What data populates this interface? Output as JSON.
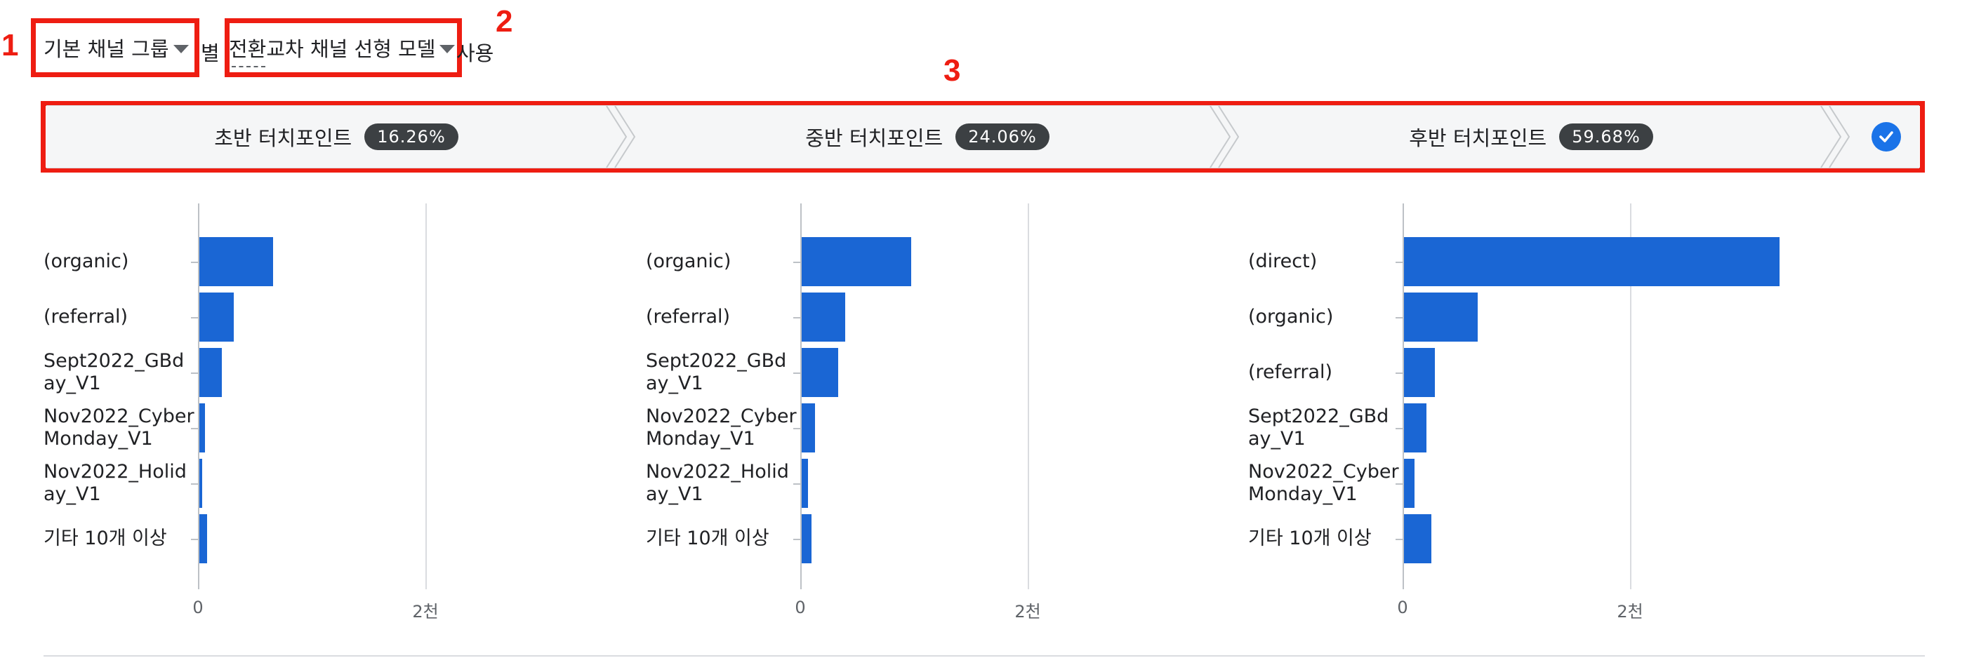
{
  "controls": {
    "channel_group": "기본 채널 그룹",
    "by_label": "별",
    "model": "전환교차 채널 선형 모델",
    "use_label": "사용"
  },
  "annotations": {
    "n1": "1",
    "n2": "2",
    "n3": "3"
  },
  "steps": [
    {
      "label": "초반 터치포인트",
      "percent": "16.26%"
    },
    {
      "label": "중반 터치포인트",
      "percent": "24.06%"
    },
    {
      "label": "후반 터치포인트",
      "percent": "59.68%"
    }
  ],
  "icons": {
    "caret": "caret-down-icon",
    "check": "check-circle-icon"
  },
  "colors": {
    "bar": "#1a66d4",
    "annotation": "#ee1d12",
    "badge": "#3c4043",
    "check": "#1a73e8"
  },
  "chart_data": [
    {
      "type": "bar",
      "orientation": "horizontal",
      "categories": [
        "(organic)",
        "(referral)",
        "Sept2022_GBday_V1",
        "Nov2022_CyberMonday_V1",
        "Nov2022_Holiday_V1",
        "기타 10개 이상"
      ],
      "labels": [
        [
          "(organic)"
        ],
        [
          "(referral)"
        ],
        [
          "Sept2022_GBd",
          "ay_V1"
        ],
        [
          "Nov2022_Cyber",
          "Monday_V1"
        ],
        [
          "Nov2022_Holid",
          "ay_V1"
        ],
        [
          "기타 10개 이상"
        ]
      ],
      "values": [
        650,
        300,
        200,
        50,
        25,
        70
      ],
      "x_ticks": [
        "0",
        "2천"
      ],
      "xlim": [
        0,
        2000
      ],
      "grid": true
    },
    {
      "type": "bar",
      "orientation": "horizontal",
      "categories": [
        "(organic)",
        "(referral)",
        "Sept2022_GBday_V1",
        "Nov2022_CyberMonday_V1",
        "Nov2022_Holiday_V1",
        "기타 10개 이상"
      ],
      "labels": [
        [
          "(organic)"
        ],
        [
          "(referral)"
        ],
        [
          "Sept2022_GBd",
          "ay_V1"
        ],
        [
          "Nov2022_Cyber",
          "Monday_V1"
        ],
        [
          "Nov2022_Holid",
          "ay_V1"
        ],
        [
          "기타 10개 이상"
        ]
      ],
      "values": [
        960,
        380,
        320,
        115,
        55,
        85
      ],
      "x_ticks": [
        "0",
        "2천"
      ],
      "xlim": [
        0,
        2000
      ],
      "grid": true
    },
    {
      "type": "bar",
      "orientation": "horizontal",
      "categories": [
        "(direct)",
        "(organic)",
        "(referral)",
        "Sept2022_GBday_V1",
        "Nov2022_CyberMonday_V1",
        "기타 10개 이상"
      ],
      "labels": [
        [
          "(direct)"
        ],
        [
          "(organic)"
        ],
        [
          "(referral)"
        ],
        [
          "Sept2022_GBd",
          "ay_V1"
        ],
        [
          "Nov2022_Cyber",
          "Monday_V1"
        ],
        [
          "기타 10개 이상"
        ]
      ],
      "values": [
        3300,
        650,
        270,
        200,
        90,
        240
      ],
      "x_ticks": [
        "0",
        "2천"
      ],
      "xlim": [
        0,
        2000
      ],
      "grid": true
    }
  ]
}
